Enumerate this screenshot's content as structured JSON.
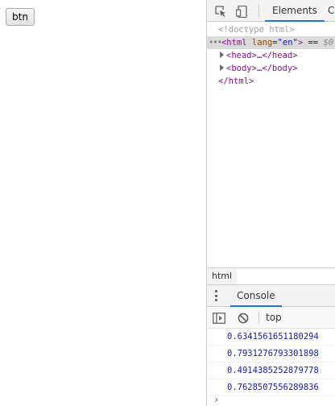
{
  "page": {
    "button_label": "btn"
  },
  "devtools": {
    "tabs": {
      "elements": "Elements",
      "console_partial": "C"
    },
    "dom": {
      "doctype": "<!doctype html>",
      "html_open": {
        "lt": "<",
        "tag": "html",
        "attr": "lang",
        "eq": "=",
        "value": "\"en\"",
        "gt": ">",
        "sel_eq": " == ",
        "sel_var": "$0"
      },
      "head": {
        "open": "<head>",
        "ellipsis": "…",
        "close": "</head>"
      },
      "body": {
        "open": "<body>",
        "ellipsis": "…",
        "close": "</body>"
      },
      "html_close": "</html>"
    },
    "breadcrumb": "html",
    "drawer": {
      "console_tab": "Console"
    },
    "console": {
      "context": "top",
      "messages": [
        "0.6341561651180294",
        "0.7931276793301898",
        "0.4914385252879778",
        "0.7628507556289836"
      ],
      "prompt": "›"
    },
    "icons": [
      "inspect-icon",
      "device-toggle-icon",
      "sidebar-toggle-icon",
      "clear-console-icon",
      "more-icon"
    ]
  }
}
